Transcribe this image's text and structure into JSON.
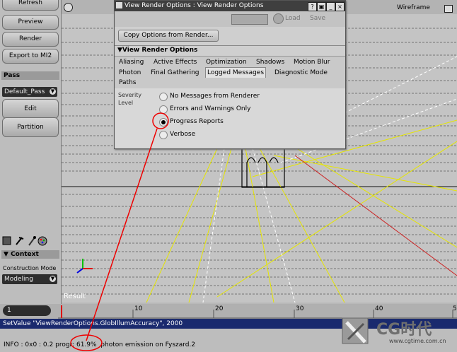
{
  "left_panel": {
    "refresh": "Refresh",
    "preview": "Preview",
    "render": "Render",
    "export": "Export to MI2",
    "pass_header": "Pass",
    "pass_value": "Default_Pass",
    "edit": "Edit",
    "partition": "Partition",
    "context_header": "Context",
    "construction_mode_label": "Construction Mode",
    "construction_mode_value": "Modeling"
  },
  "viewport": {
    "label": "Result",
    "view_mode": "Wireframe"
  },
  "dialog": {
    "title": "View Render Options : View Render Options",
    "load": "Load",
    "save": "Save",
    "copy_options": "Copy Options from Render...",
    "section": "View Render Options",
    "tabs_row1": [
      "Aliasing",
      "Active Effects",
      "Optimization",
      "Shadows",
      "Motion Blur"
    ],
    "tabs_row2": [
      "Photon",
      "Final Gathering",
      "Logged Messages",
      "Diagnostic Mode"
    ],
    "tabs_row3": [
      "Paths"
    ],
    "active_tab": "Logged Messages",
    "severity_label": "Severity Level",
    "options": [
      "No Messages from Renderer",
      "Errors and Warnings Only",
      "Progress Reports",
      "Verbose"
    ],
    "selected_option": "Progress Reports"
  },
  "timeline": {
    "current_frame": "1",
    "ticks": [
      "10",
      "20",
      "30",
      "40",
      "5"
    ]
  },
  "command_line": "SetValue \"ViewRenderOptions.GlobIllumAccuracy\", 2000",
  "status": {
    "text": "INFO : 0x0 : 0.2 progr: 61.9%  photon emission on Fyszard.2"
  },
  "watermark": {
    "logo": "CG时代",
    "url": "www.cgtime.com.cn"
  }
}
